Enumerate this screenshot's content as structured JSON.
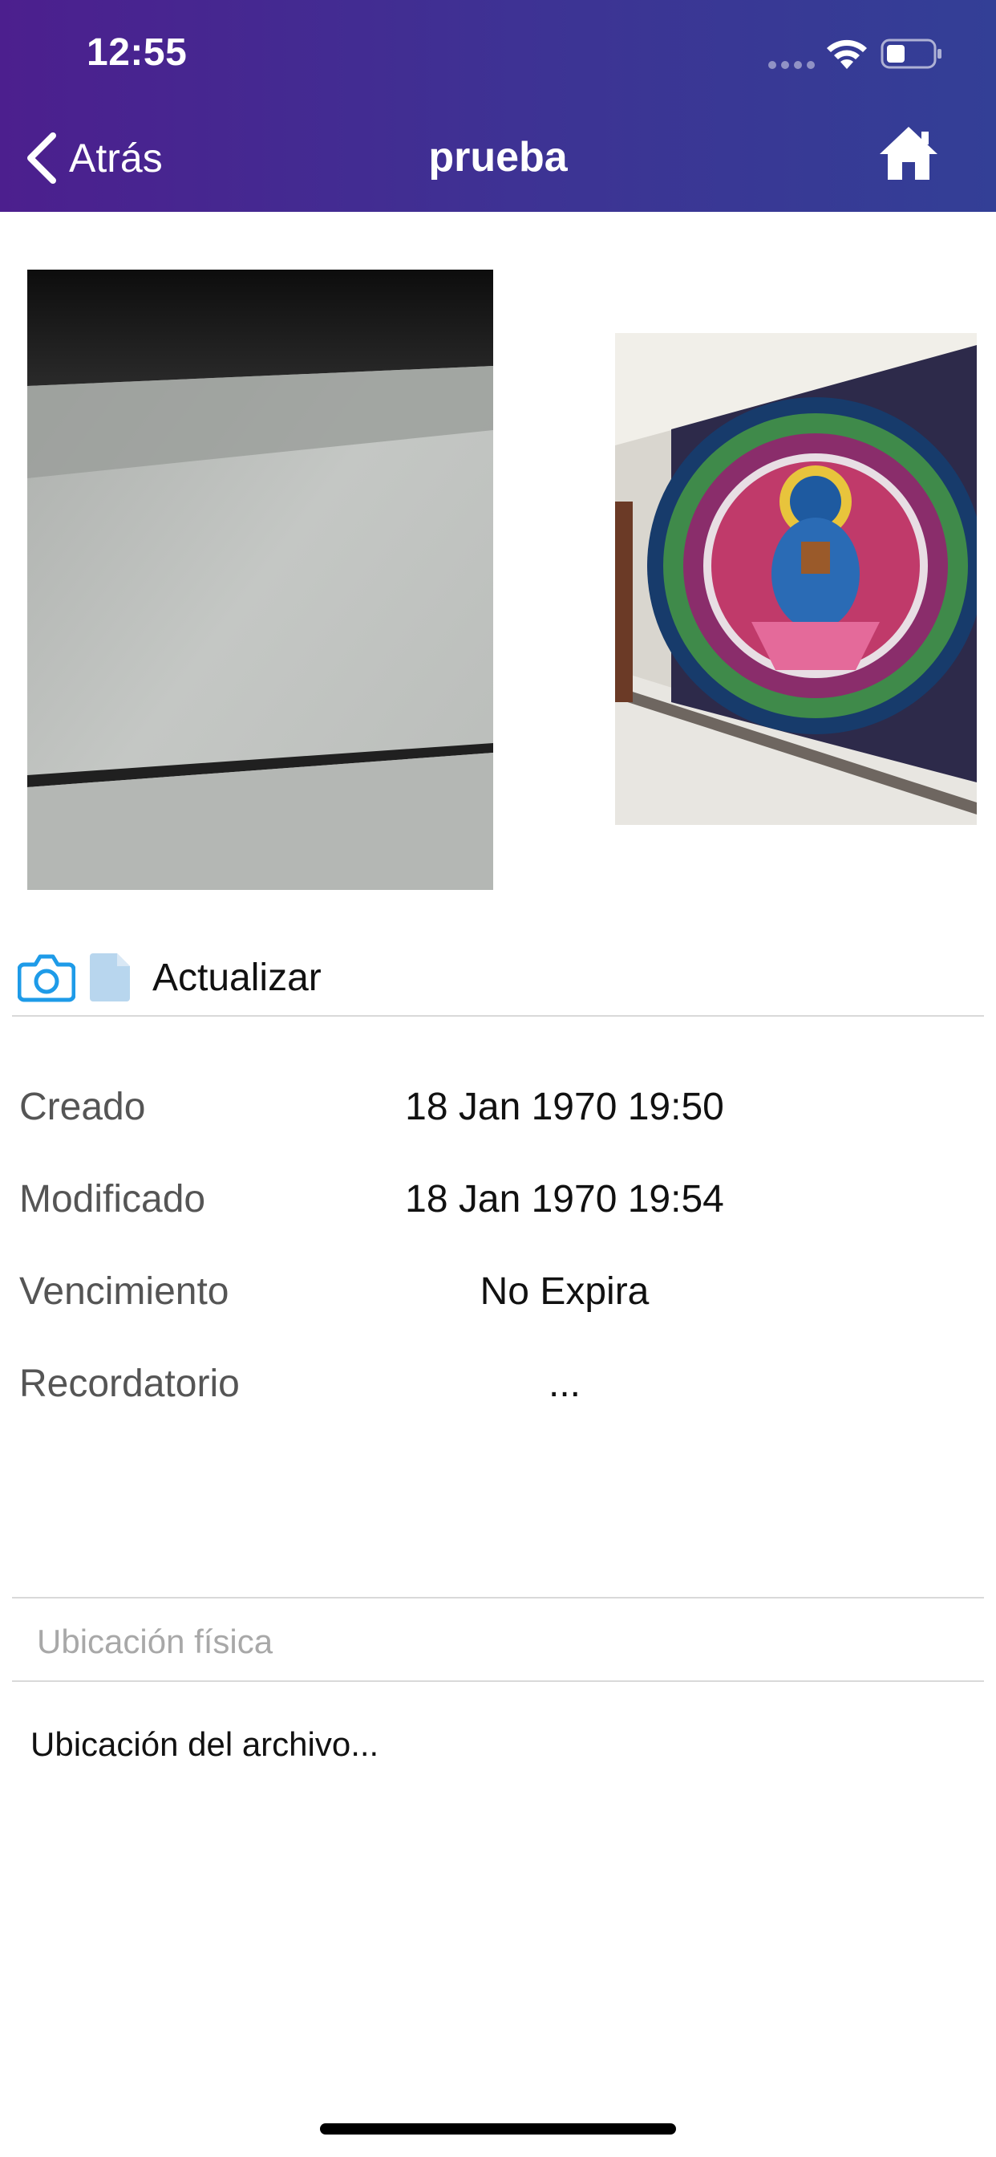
{
  "status_bar": {
    "time": "12:55"
  },
  "nav": {
    "back_label": "Atrás",
    "title": "prueba",
    "home_icon": "home-icon",
    "back_icon": "chevron-left-icon"
  },
  "images": [
    {
      "name": "image-thumbnail-surface"
    },
    {
      "name": "image-thumbnail-mural"
    }
  ],
  "actions": {
    "camera_icon": "camera-icon",
    "file_icon": "file-icon",
    "update_label": "Actualizar"
  },
  "details": [
    {
      "label": "Creado",
      "value": "18 Jan 1970 19:50"
    },
    {
      "label": "Modificado",
      "value": "18 Jan 1970 19:54"
    },
    {
      "label": "Vencimiento",
      "value": "No Expira"
    },
    {
      "label": "Recordatorio",
      "value": "..."
    }
  ],
  "location": {
    "physical_placeholder": "Ubicación física",
    "file_location_text": "Ubicación del archivo..."
  },
  "colors": {
    "header_start": "#4c1f8e",
    "header_end": "#333f96",
    "camera_blue": "#1e9be8",
    "file_icon_blue": "#b8d6ee"
  }
}
